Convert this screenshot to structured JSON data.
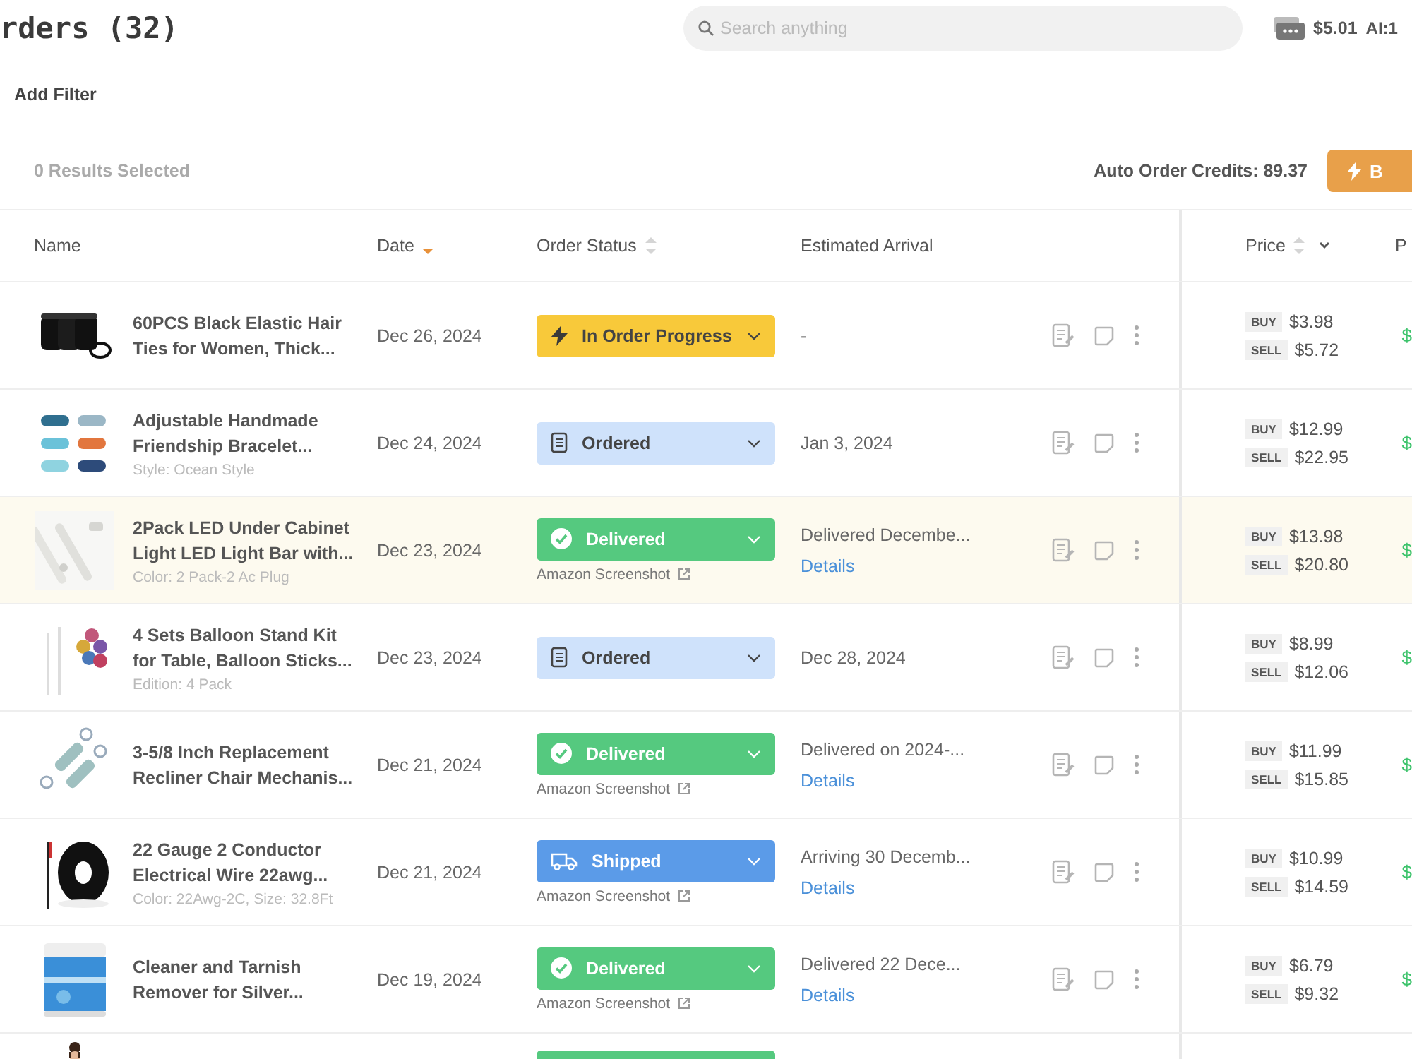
{
  "header": {
    "title": "rders (32)",
    "search": {
      "placeholder": "Search anything"
    },
    "balance": "$5.01",
    "ai_credits": "AI:1"
  },
  "filter_bar": {
    "add_filter": "Add Filter"
  },
  "selection_bar": {
    "selected_count": "0 Results Selected",
    "credits": "Auto Order Credits: 89.37",
    "action_button": "B"
  },
  "table": {
    "columns": [
      {
        "label": "Name"
      },
      {
        "label": "Date",
        "sorted": true
      },
      {
        "label": "Order Status",
        "sorted": false
      },
      {
        "label": "Estimated Arrival"
      },
      {
        "label": "Price",
        "sorted": false,
        "menu": true
      },
      {
        "label": "P"
      }
    ],
    "rows": [
      {
        "name": "60PCS Black Elastic Hair Ties for Women, Thick...",
        "date": "Dec 26, 2024",
        "status": {
          "kind": "progress",
          "label": "In Order Progress"
        },
        "arrival": "-",
        "buy_tag": "BUY",
        "buy": "$3.98",
        "sell_tag": "SELL",
        "sell": "$5.72",
        "profit": "$",
        "highlighted": false
      },
      {
        "name": "Adjustable Handmade Friendship Bracelet...",
        "variant": "Style: Ocean Style",
        "date": "Dec 24, 2024",
        "status": {
          "kind": "ordered",
          "label": "Ordered"
        },
        "arrival": "Jan 3, 2024",
        "buy_tag": "BUY",
        "buy": "$12.99",
        "sell_tag": "SELL",
        "sell": "$22.95",
        "profit": "$",
        "highlighted": false
      },
      {
        "name": "2Pack LED Under Cabinet Light LED Light Bar with...",
        "variant": "Color: 2 Pack-2 Ac Plug",
        "date": "Dec 23, 2024",
        "status": {
          "kind": "delivered",
          "label": "Delivered"
        },
        "screenshot_link": "Amazon Screenshot",
        "arrival": "Delivered Decembe...",
        "details": "Details",
        "buy_tag": "BUY",
        "buy": "$13.98",
        "sell_tag": "SELL",
        "sell": "$20.80",
        "profit": "$",
        "highlighted": true
      },
      {
        "name": "4 Sets Balloon Stand Kit for Table, Balloon Sticks...",
        "variant": "Edition: 4 Pack",
        "date": "Dec 23, 2024",
        "status": {
          "kind": "ordered",
          "label": "Ordered"
        },
        "arrival": "Dec 28, 2024",
        "buy_tag": "BUY",
        "buy": "$8.99",
        "sell_tag": "SELL",
        "sell": "$12.06",
        "profit": "$",
        "highlighted": false
      },
      {
        "name": "3-5/8 Inch Replacement Recliner Chair Mechanis...",
        "date": "Dec 21, 2024",
        "status": {
          "kind": "delivered",
          "label": "Delivered"
        },
        "screenshot_link": "Amazon Screenshot",
        "arrival": "Delivered on 2024-...",
        "details": "Details",
        "buy_tag": "BUY",
        "buy": "$11.99",
        "sell_tag": "SELL",
        "sell": "$15.85",
        "profit": "$",
        "highlighted": false
      },
      {
        "name": "22 Gauge 2 Conductor Electrical Wire 22awg...",
        "variant": "Color: 22Awg-2C, Size: 32.8Ft",
        "date": "Dec 21, 2024",
        "status": {
          "kind": "shipped",
          "label": "Shipped"
        },
        "screenshot_link": "Amazon Screenshot",
        "arrival": "Arriving 30 Decemb...",
        "details": "Details",
        "buy_tag": "BUY",
        "buy": "$10.99",
        "sell_tag": "SELL",
        "sell": "$14.59",
        "profit": "$",
        "highlighted": false
      },
      {
        "name": "Cleaner and Tarnish Remover for Silver...",
        "date": "Dec 19, 2024",
        "status": {
          "kind": "delivered",
          "label": "Delivered"
        },
        "screenshot_link": "Amazon Screenshot",
        "arrival": "Delivered 22 Dece...",
        "details": "Details",
        "buy_tag": "BUY",
        "buy": "$6.79",
        "sell_tag": "SELL",
        "sell": "$9.32",
        "profit": "$",
        "highlighted": false
      },
      {
        "status": {
          "kind": "delivered"
        },
        "highlighted": false
      }
    ]
  }
}
